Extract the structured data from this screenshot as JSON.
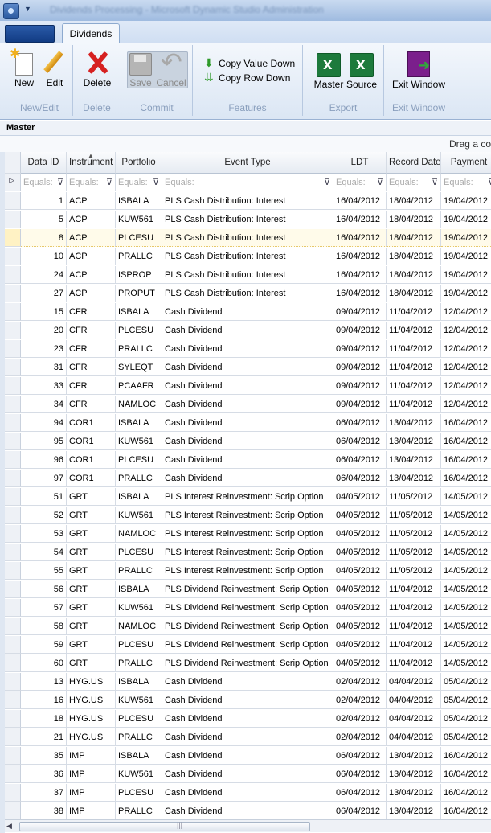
{
  "window": {
    "title": "Dividends Processing - Microsoft Dynamic Studio Administration"
  },
  "tabs": {
    "active": "Dividends"
  },
  "ribbon": {
    "groups": {
      "new_edit": {
        "caption": "New/Edit",
        "new": "New",
        "edit": "Edit"
      },
      "delete": {
        "caption": "Delete",
        "delete": "Delete"
      },
      "commit": {
        "caption": "Commit",
        "save": "Save",
        "cancel": "Cancel"
      },
      "features": {
        "caption": "Features",
        "copy_value": "Copy Value Down",
        "copy_row": "Copy Row Down"
      },
      "export": {
        "caption": "Export",
        "master": "Master",
        "source": "Source"
      },
      "exit": {
        "caption": "Exit Window",
        "exit": "Exit Window"
      }
    }
  },
  "master": {
    "label": "Master",
    "drag_hint": "Drag a co"
  },
  "grid": {
    "columns": [
      "Data ID",
      "Instrument",
      "Portfolio",
      "Event Type",
      "LDT",
      "Record Date",
      "Payment"
    ],
    "filter_placeholder": "Equals:",
    "current_row_index": 2,
    "rows": [
      [
        "1",
        "ACP",
        "ISBALA",
        "PLS Cash Distribution: Interest",
        "16/04/2012",
        "18/04/2012",
        "19/04/2012"
      ],
      [
        "5",
        "ACP",
        "KUW561",
        "PLS Cash Distribution: Interest",
        "16/04/2012",
        "18/04/2012",
        "19/04/2012"
      ],
      [
        "8",
        "ACP",
        "PLCESU",
        "PLS Cash Distribution: Interest",
        "16/04/2012",
        "18/04/2012",
        "19/04/2012"
      ],
      [
        "10",
        "ACP",
        "PRALLC",
        "PLS Cash Distribution: Interest",
        "16/04/2012",
        "18/04/2012",
        "19/04/2012"
      ],
      [
        "24",
        "ACP",
        "ISPROP",
        "PLS Cash Distribution: Interest",
        "16/04/2012",
        "18/04/2012",
        "19/04/2012"
      ],
      [
        "27",
        "ACP",
        "PROPUT",
        "PLS Cash Distribution: Interest",
        "16/04/2012",
        "18/04/2012",
        "19/04/2012"
      ],
      [
        "15",
        "CFR",
        "ISBALA",
        "Cash Dividend",
        "09/04/2012",
        "11/04/2012",
        "12/04/2012"
      ],
      [
        "20",
        "CFR",
        "PLCESU",
        "Cash Dividend",
        "09/04/2012",
        "11/04/2012",
        "12/04/2012"
      ],
      [
        "23",
        "CFR",
        "PRALLC",
        "Cash Dividend",
        "09/04/2012",
        "11/04/2012",
        "12/04/2012"
      ],
      [
        "31",
        "CFR",
        "SYLEQT",
        "Cash Dividend",
        "09/04/2012",
        "11/04/2012",
        "12/04/2012"
      ],
      [
        "33",
        "CFR",
        "PCAAFR",
        "Cash Dividend",
        "09/04/2012",
        "11/04/2012",
        "12/04/2012"
      ],
      [
        "34",
        "CFR",
        "NAMLOC",
        "Cash Dividend",
        "09/04/2012",
        "11/04/2012",
        "12/04/2012"
      ],
      [
        "94",
        "COR1",
        "ISBALA",
        "Cash Dividend",
        "06/04/2012",
        "13/04/2012",
        "16/04/2012"
      ],
      [
        "95",
        "COR1",
        "KUW561",
        "Cash Dividend",
        "06/04/2012",
        "13/04/2012",
        "16/04/2012"
      ],
      [
        "96",
        "COR1",
        "PLCESU",
        "Cash Dividend",
        "06/04/2012",
        "13/04/2012",
        "16/04/2012"
      ],
      [
        "97",
        "COR1",
        "PRALLC",
        "Cash Dividend",
        "06/04/2012",
        "13/04/2012",
        "16/04/2012"
      ],
      [
        "51",
        "GRT",
        "ISBALA",
        "PLS Interest Reinvestment: Scrip Option",
        "04/05/2012",
        "11/05/2012",
        "14/05/2012"
      ],
      [
        "52",
        "GRT",
        "KUW561",
        "PLS Interest Reinvestment: Scrip Option",
        "04/05/2012",
        "11/05/2012",
        "14/05/2012"
      ],
      [
        "53",
        "GRT",
        "NAMLOC",
        "PLS Interest Reinvestment: Scrip Option",
        "04/05/2012",
        "11/05/2012",
        "14/05/2012"
      ],
      [
        "54",
        "GRT",
        "PLCESU",
        "PLS Interest Reinvestment: Scrip Option",
        "04/05/2012",
        "11/05/2012",
        "14/05/2012"
      ],
      [
        "55",
        "GRT",
        "PRALLC",
        "PLS Interest Reinvestment: Scrip Option",
        "04/05/2012",
        "11/05/2012",
        "14/05/2012"
      ],
      [
        "56",
        "GRT",
        "ISBALA",
        "PLS Dividend Reinvestment: Scrip Option",
        "04/05/2012",
        "11/04/2012",
        "14/05/2012"
      ],
      [
        "57",
        "GRT",
        "KUW561",
        "PLS Dividend Reinvestment: Scrip Option",
        "04/05/2012",
        "11/04/2012",
        "14/05/2012"
      ],
      [
        "58",
        "GRT",
        "NAMLOC",
        "PLS Dividend Reinvestment: Scrip Option",
        "04/05/2012",
        "11/04/2012",
        "14/05/2012"
      ],
      [
        "59",
        "GRT",
        "PLCESU",
        "PLS Dividend Reinvestment: Scrip Option",
        "04/05/2012",
        "11/04/2012",
        "14/05/2012"
      ],
      [
        "60",
        "GRT",
        "PRALLC",
        "PLS Dividend Reinvestment: Scrip Option",
        "04/05/2012",
        "11/04/2012",
        "14/05/2012"
      ],
      [
        "13",
        "HYG.US",
        "ISBALA",
        "Cash Dividend",
        "02/04/2012",
        "04/04/2012",
        "05/04/2012"
      ],
      [
        "16",
        "HYG.US",
        "KUW561",
        "Cash Dividend",
        "02/04/2012",
        "04/04/2012",
        "05/04/2012"
      ],
      [
        "18",
        "HYG.US",
        "PLCESU",
        "Cash Dividend",
        "02/04/2012",
        "04/04/2012",
        "05/04/2012"
      ],
      [
        "21",
        "HYG.US",
        "PRALLC",
        "Cash Dividend",
        "02/04/2012",
        "04/04/2012",
        "05/04/2012"
      ],
      [
        "35",
        "IMP",
        "ISBALA",
        "Cash Dividend",
        "06/04/2012",
        "13/04/2012",
        "16/04/2012"
      ],
      [
        "36",
        "IMP",
        "KUW561",
        "Cash Dividend",
        "06/04/2012",
        "13/04/2012",
        "16/04/2012"
      ],
      [
        "37",
        "IMP",
        "PLCESU",
        "Cash Dividend",
        "06/04/2012",
        "13/04/2012",
        "16/04/2012"
      ],
      [
        "38",
        "IMP",
        "PRALLC",
        "Cash Dividend",
        "06/04/2012",
        "13/04/2012",
        "16/04/2012"
      ]
    ]
  }
}
